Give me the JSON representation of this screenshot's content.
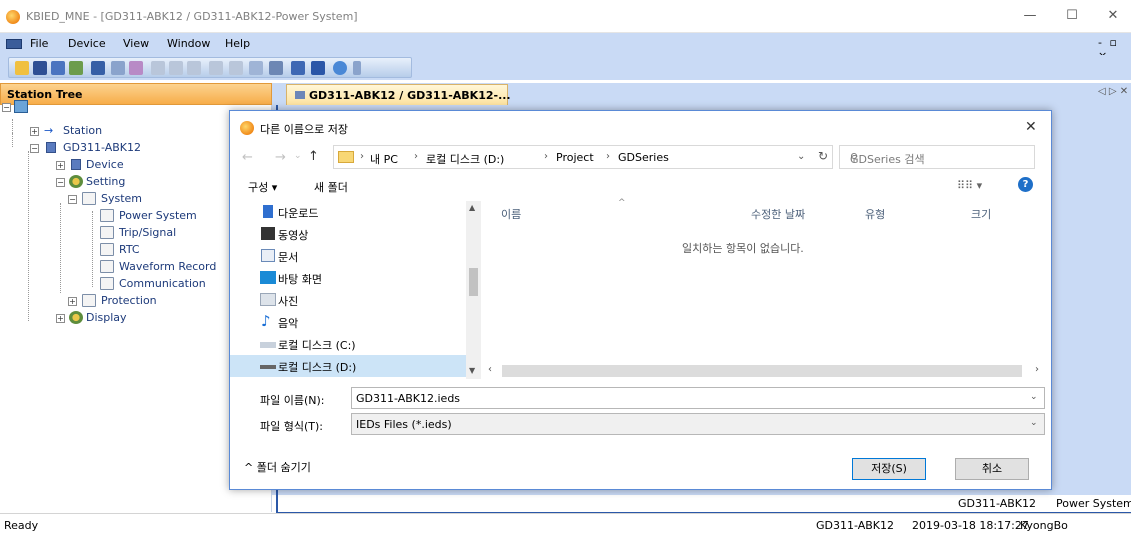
{
  "window": {
    "title": "KBIED_MNE - [GD311-ABK12 / GD311-ABK12-Power System]",
    "controls": {
      "minimize": "—",
      "maximize": "☐",
      "close": "✕"
    }
  },
  "menu": {
    "items": [
      "File",
      "Device",
      "View",
      "Window",
      "Help"
    ],
    "mdi_controls": "- ▫ ×"
  },
  "station_tree": {
    "header": "Station Tree",
    "nodes": {
      "station": "Station",
      "device_root": "GD311-ABK12",
      "device": "Device",
      "setting": "Setting",
      "system": "System",
      "power_system": "Power System",
      "trip_signal": "Trip/Signal",
      "rtc": "RTC",
      "waveform_record": "Waveform Record",
      "communication": "Communication",
      "protection": "Protection",
      "display": "Display"
    }
  },
  "document": {
    "tab_label": "GD311-ABK12 / GD311-ABK12-...",
    "tab_arrows": "◁ ▷ ✕",
    "bottom_device": "GD311-ABK12",
    "bottom_page": "Power System"
  },
  "status_bar": {
    "left": "Ready",
    "device": "GD311-ABK12",
    "datetime": "2019-03-18 18:17:27",
    "user": "KyongBo"
  },
  "dialog": {
    "title": "다른 이름으로 저장",
    "close": "✕",
    "address": {
      "crumbs": [
        "내 PC",
        "로컬 디스크 (D:)",
        "Project",
        "GDSeries"
      ]
    },
    "search_placeholder": "GDSeries 검색",
    "organize": "구성 ▾",
    "new_folder": "새 폴더",
    "view_icon": "⠿⠿ ▾",
    "help": "?",
    "nav_items": [
      {
        "label": "다운로드",
        "icon": "download-icon",
        "color": "#2f6fcf"
      },
      {
        "label": "동영상",
        "icon": "video-icon",
        "color": "#333333"
      },
      {
        "label": "문서",
        "icon": "document-icon",
        "color": "#6a8ab8"
      },
      {
        "label": "바탕 화면",
        "icon": "desktop-icon",
        "color": "#1a8ad6"
      },
      {
        "label": "사진",
        "icon": "pictures-icon",
        "color": "#9aa7b8"
      },
      {
        "label": "음악",
        "icon": "music-icon",
        "color": "#1a6fd6"
      },
      {
        "label": "로컬 디스크 (C:)",
        "icon": "drive-c-icon",
        "color": "#7b8fa8"
      },
      {
        "label": "로컬 디스크 (D:)",
        "icon": "drive-d-icon",
        "color": "#666666"
      }
    ],
    "columns": [
      "이름",
      "수정한 날짜",
      "유형",
      "크기"
    ],
    "empty_message": "일치하는 항목이 없습니다.",
    "filename_label": "파일 이름(N):",
    "filename_value": "GD311-ABK12.ieds",
    "filetype_label": "파일 형식(T):",
    "filetype_value": "IEDs Files (*.ieds)",
    "hide_folders": "^ 폴더 숨기기",
    "save_button": "저장(S)",
    "cancel_button": "취소"
  }
}
